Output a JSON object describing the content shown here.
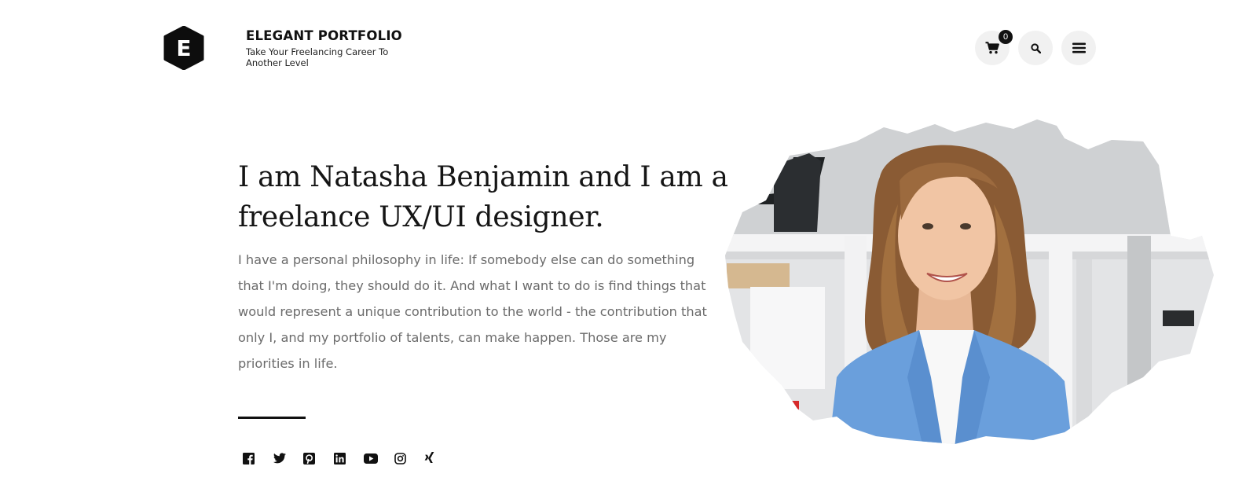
{
  "brand": {
    "logo_letter": "E",
    "title": "ELEGANT PORTFOLIO",
    "tagline": "Take Your Freelancing Career To Another Level"
  },
  "header": {
    "cart_count": "0",
    "icons": [
      "cart-icon",
      "search-icon",
      "hamburger-menu-icon"
    ]
  },
  "hero": {
    "title": "I am Natasha Benjamin and I am a freelance UX/UI designer.",
    "body": "I have a personal philosophy in life: If somebody else can do something that I'm doing, they should do it. And what I want to do is find things that would represent a unique contribution to the world - the contribution that only I, and my portfolio of talents, can make happen. Those are my priorities in life."
  },
  "socials": [
    "facebook-icon",
    "twitter-icon",
    "pinterest-icon",
    "linkedin-icon",
    "youtube-icon",
    "instagram-icon",
    "xing-icon"
  ],
  "colors": {
    "text_dark": "#111111",
    "text_body": "#6b6b6b",
    "button_bg": "#f1f1f1",
    "blazer_blue": "#6a9fdc"
  }
}
